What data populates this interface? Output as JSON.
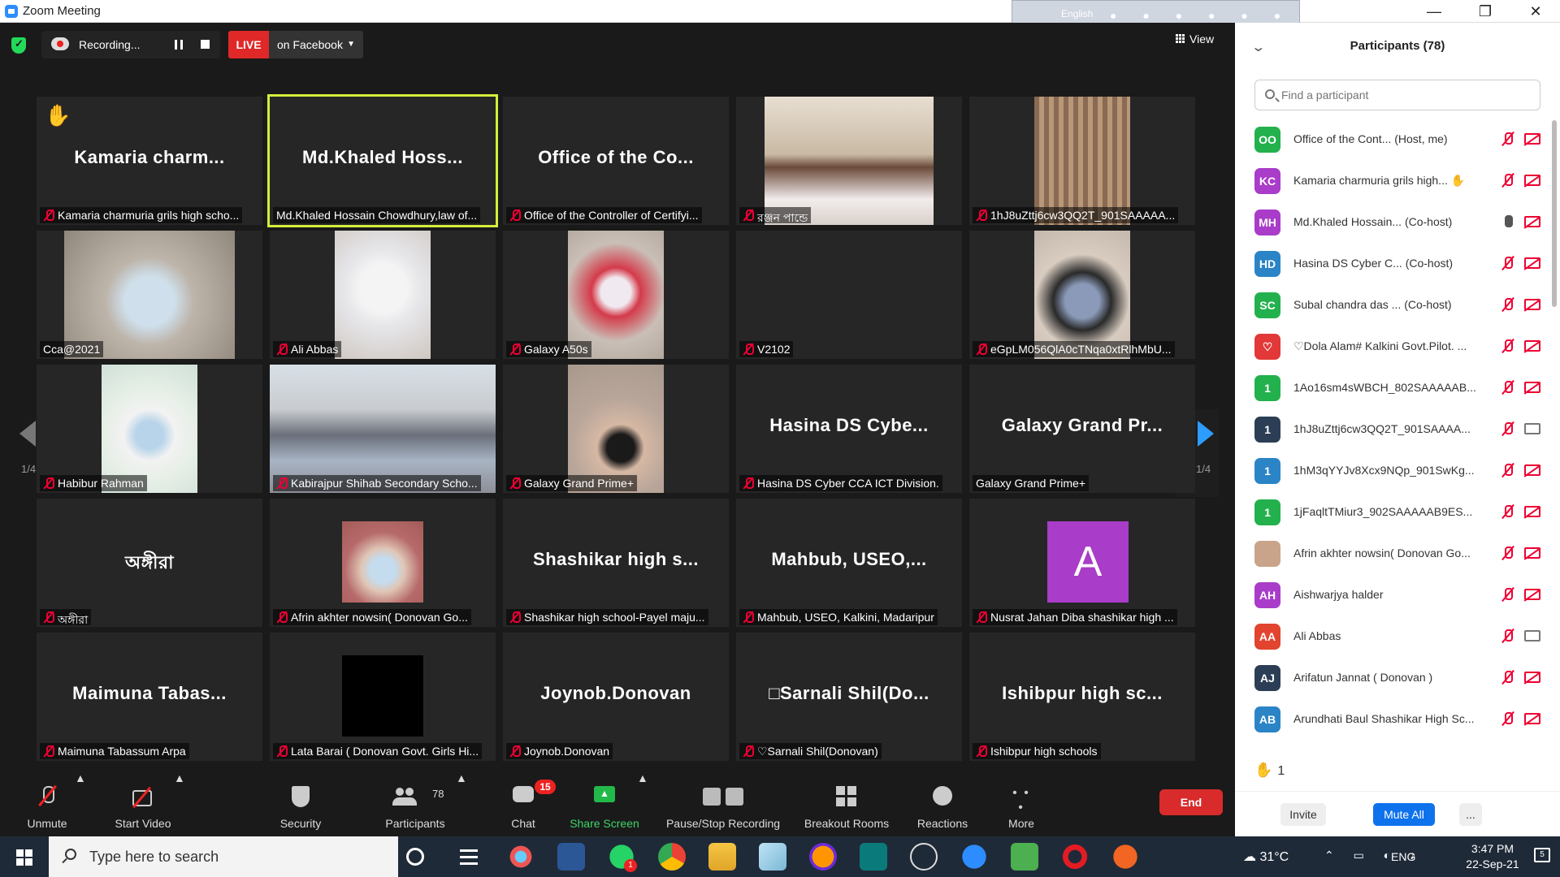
{
  "window": {
    "title": "Zoom Meeting",
    "lang_bar": "English"
  },
  "recording": {
    "status": "Recording...",
    "live": "LIVE",
    "destination": "on Facebook"
  },
  "view_label": "View",
  "pagination": {
    "page": "1/4"
  },
  "tiles": [
    {
      "big": "Kamaria  charm...",
      "caption": "Kamaria charmuria grils high scho...",
      "hand": "✋"
    },
    {
      "big": "Md.Khaled  Hoss...",
      "caption": "Md.Khaled Hossain Chowdhury,law of..."
    },
    {
      "big": "Office  of  the  Co...",
      "caption": "Office of the Controller of Certifyi..."
    },
    {
      "caption": "রঞ্জন পান্ডে"
    },
    {
      "caption": "1hJ8uZttj6cw3QQ2T_901SAAAAA..."
    },
    {
      "caption": "Cca@2021"
    },
    {
      "caption": "Ali Abbas"
    },
    {
      "caption": "Galaxy A50s"
    },
    {
      "caption": "V2102"
    },
    {
      "caption": "eGpLM056QlA0cTNqa0xtRlhMbU..."
    },
    {
      "caption": "Habibur Rahman"
    },
    {
      "caption": "Kabirajpur Shihab Secondary Scho..."
    },
    {
      "caption": "Galaxy Grand Prime+"
    },
    {
      "big": "Hasina  DS  Cybe...",
      "caption": "Hasina DS Cyber CCA ICT Division."
    },
    {
      "big": "Galaxy  Grand  Pr...",
      "caption": "Galaxy Grand Prime+"
    },
    {
      "big": "অঙ্গীরা",
      "caption": "অঙ্গীরা"
    },
    {
      "caption": "Afrin akhter nowsin( Donovan Go..."
    },
    {
      "big": "Shashikar  high  s...",
      "caption": "Shashikar high school-Payel maju..."
    },
    {
      "big": "Mahbub,  USEO,...",
      "caption": "Mahbub, USEO, Kalkini, Madaripur"
    },
    {
      "caption": "Nusrat Jahan Diba shashikar high ...",
      "avatar": "A"
    },
    {
      "big": "Maimuna  Tabas...",
      "caption": "Maimuna Tabassum Arpa"
    },
    {
      "caption": "Lata Barai ( Donovan Govt. Girls Hi..."
    },
    {
      "big": "Joynob.Donovan",
      "caption": "Joynob.Donovan"
    },
    {
      "big": "□Sarnali  Shil(Do...",
      "caption": "♡Sarnali Shil(Donovan)"
    },
    {
      "big": "Ishibpur  high  sc...",
      "caption": "Ishibpur high schools"
    }
  ],
  "toolbar": {
    "unmute": "Unmute",
    "start_video": "Start Video",
    "security": "Security",
    "participants": "Participants",
    "participants_count": "78",
    "chat": "Chat",
    "chat_badge": "15",
    "share_screen": "Share Screen",
    "pause_recording": "Pause/Stop Recording",
    "breakout_rooms": "Breakout Rooms",
    "reactions": "Reactions",
    "more": "More",
    "end": "End"
  },
  "panel": {
    "title": "Participants (78)",
    "search_placeholder": "Find a participant",
    "participants": [
      {
        "initials": "OO",
        "color": "#23b14d",
        "name": "Office of the Cont...  (Host, me)",
        "mic": "off",
        "cam": "off"
      },
      {
        "initials": "KC",
        "color": "#a93cc8",
        "name": "Kamaria charmuria grils high... ✋",
        "mic": "off",
        "cam": "off"
      },
      {
        "initials": "MH",
        "color": "#a93cc8",
        "name": "Md.Khaled Hossain...  (Co-host)",
        "mic": "on",
        "cam": "off"
      },
      {
        "initials": "HD",
        "color": "#2a84c6",
        "name": "Hasina DS Cyber C...  (Co-host)",
        "mic": "off",
        "cam": "off"
      },
      {
        "initials": "SC",
        "color": "#23b14d",
        "name": "Subal chandra das ...  (Co-host)",
        "mic": "off",
        "cam": "off"
      },
      {
        "initials": "♡",
        "color": "#e23838",
        "name": "♡Dola Alam# Kalkini Govt.Pilot. ...",
        "mic": "off",
        "cam": "off"
      },
      {
        "initials": "1",
        "color": "#23b14d",
        "name": "1Ao16sm4sWBCH_802SAAAAAB...",
        "mic": "off",
        "cam": "off"
      },
      {
        "initials": "1",
        "color": "#2c3e55",
        "name": "1hJ8uZttj6cw3QQ2T_901SAAAA...",
        "mic": "off",
        "cam": "on"
      },
      {
        "initials": "1",
        "color": "#2a84c6",
        "name": "1hM3qYYJv8Xcx9NQp_901SwKg...",
        "mic": "off",
        "cam": "off"
      },
      {
        "initials": "1",
        "color": "#23b14d",
        "name": "1jFaqltTMiur3_902SAAAAAB9ES...",
        "mic": "off",
        "cam": "off"
      },
      {
        "initials": "",
        "color": "#c9a48a",
        "name": "Afrin akhter nowsin( Donovan Go...",
        "mic": "off",
        "cam": "off"
      },
      {
        "initials": "AH",
        "color": "#a93cc8",
        "name": "Aishwarjya halder",
        "mic": "off",
        "cam": "off"
      },
      {
        "initials": "AA",
        "color": "#e2442f",
        "name": "Ali Abbas",
        "mic": "off",
        "cam": "on"
      },
      {
        "initials": "AJ",
        "color": "#2c3e55",
        "name": "Arifatun Jannat ( Donovan )",
        "mic": "off",
        "cam": "off"
      },
      {
        "initials": "AB",
        "color": "#2a84c6",
        "name": "Arundhati Baul Shashikar High Sc...",
        "mic": "off",
        "cam": "off"
      }
    ],
    "raised_hands": "1",
    "invite": "Invite",
    "mute_all": "Mute All",
    "more": "..."
  },
  "taskbar": {
    "search_placeholder": "Type here to search",
    "weather": "31°C",
    "lang": "ENG",
    "time": "3:47 PM",
    "date": "22-Sep-21",
    "notifications": "5",
    "whatsapp_badge": "1"
  }
}
